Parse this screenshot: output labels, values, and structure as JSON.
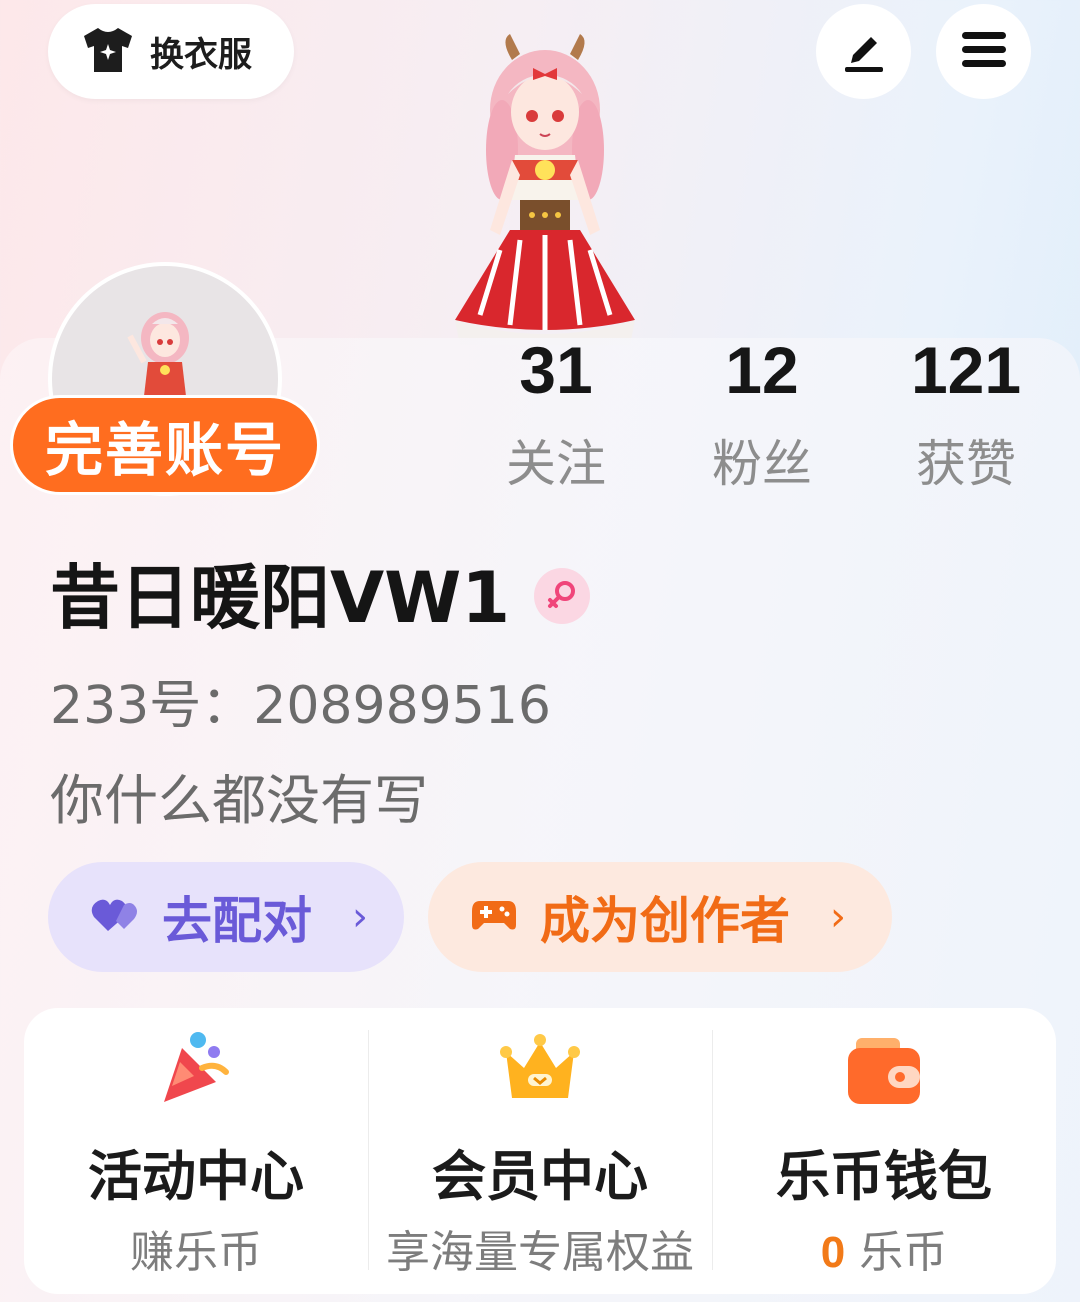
{
  "header": {
    "change_outfit_label": "换衣服",
    "edit_icon": "pen-icon",
    "menu_icon": "hamburger-icon"
  },
  "profile": {
    "complete_account_label": "完善账号",
    "stats": [
      {
        "value": "31",
        "label": "关注"
      },
      {
        "value": "12",
        "label": "粉丝"
      },
      {
        "value": "121",
        "label": "获赞"
      }
    ],
    "username": "昔日暖阳VW1",
    "gender_icon": "female-icon",
    "user_id": "233号：208989516",
    "bio": "你什么都没有写"
  },
  "actions": {
    "match_label": "去配对",
    "creator_label": "成为创作者",
    "chevron": "›"
  },
  "services": [
    {
      "title": "活动中心",
      "sub": "赚乐币",
      "icon": "party-popper-icon"
    },
    {
      "title": "会员中心",
      "sub": "享海量专属权益",
      "icon": "crown-icon"
    },
    {
      "title": "乐币钱包",
      "coin": "0",
      "sub": "乐币",
      "icon": "wallet-icon"
    }
  ],
  "colors": {
    "accent_orange": "#ff6d1f",
    "match_purple": "#6a5ad8",
    "creator_orange": "#f16b16"
  }
}
